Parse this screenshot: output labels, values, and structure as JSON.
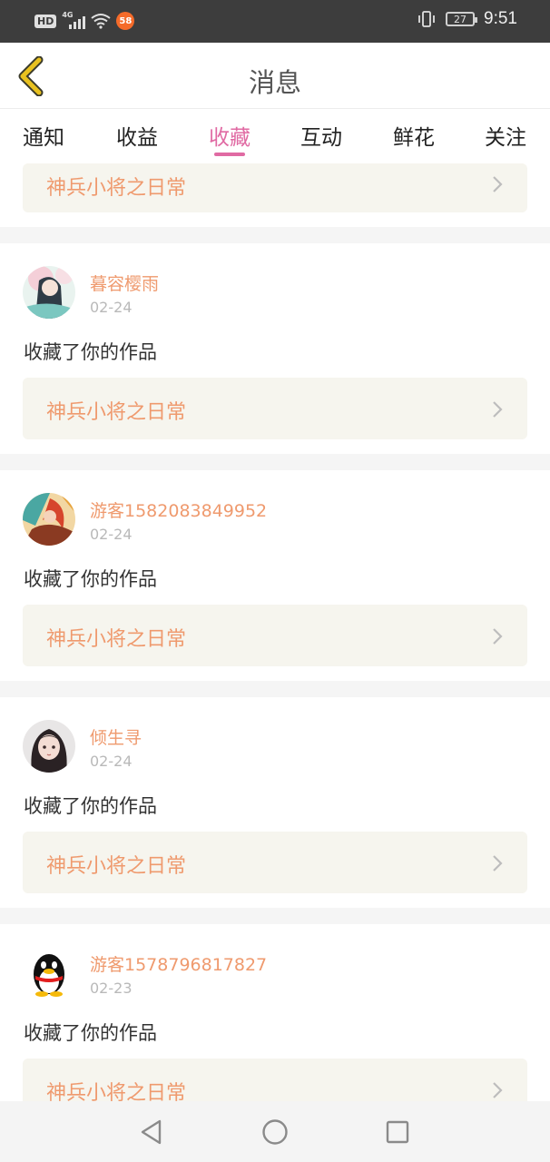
{
  "status_bar": {
    "hd": "HD",
    "net": "4G",
    "app_badge": "58",
    "battery": "27",
    "time": "9:51"
  },
  "header": {
    "title": "消息"
  },
  "tabs": [
    "通知",
    "收益",
    "收藏",
    "互动",
    "鲜花",
    "关注"
  ],
  "active_tab": "收藏",
  "top_partial_card": {
    "work_title": "神兵小将之日常"
  },
  "items": [
    {
      "username": "暮容樱雨",
      "date": "02-24",
      "action": "收藏了你的作品",
      "work_title": "神兵小将之日常",
      "avatar": "anime-girl-avatar"
    },
    {
      "username": "游客1582083849952",
      "date": "02-24",
      "action": "收藏了你的作品",
      "work_title": "神兵小将之日常",
      "avatar": "colorful-art-avatar"
    },
    {
      "username": "倾生寻",
      "date": "02-24",
      "action": "收藏了你的作品",
      "work_title": "神兵小将之日常",
      "avatar": "dark-hair-girl-avatar"
    },
    {
      "username": "游客1578796817827",
      "date": "02-23",
      "action": "收藏了你的作品",
      "work_title": "神兵小将之日常",
      "avatar": "qq-penguin-avatar"
    }
  ],
  "colors": {
    "accent": "#e06aa3",
    "username": "#ef9a6e",
    "link_bg": "#f6f5ee",
    "back_icon": "#e8c11f"
  }
}
